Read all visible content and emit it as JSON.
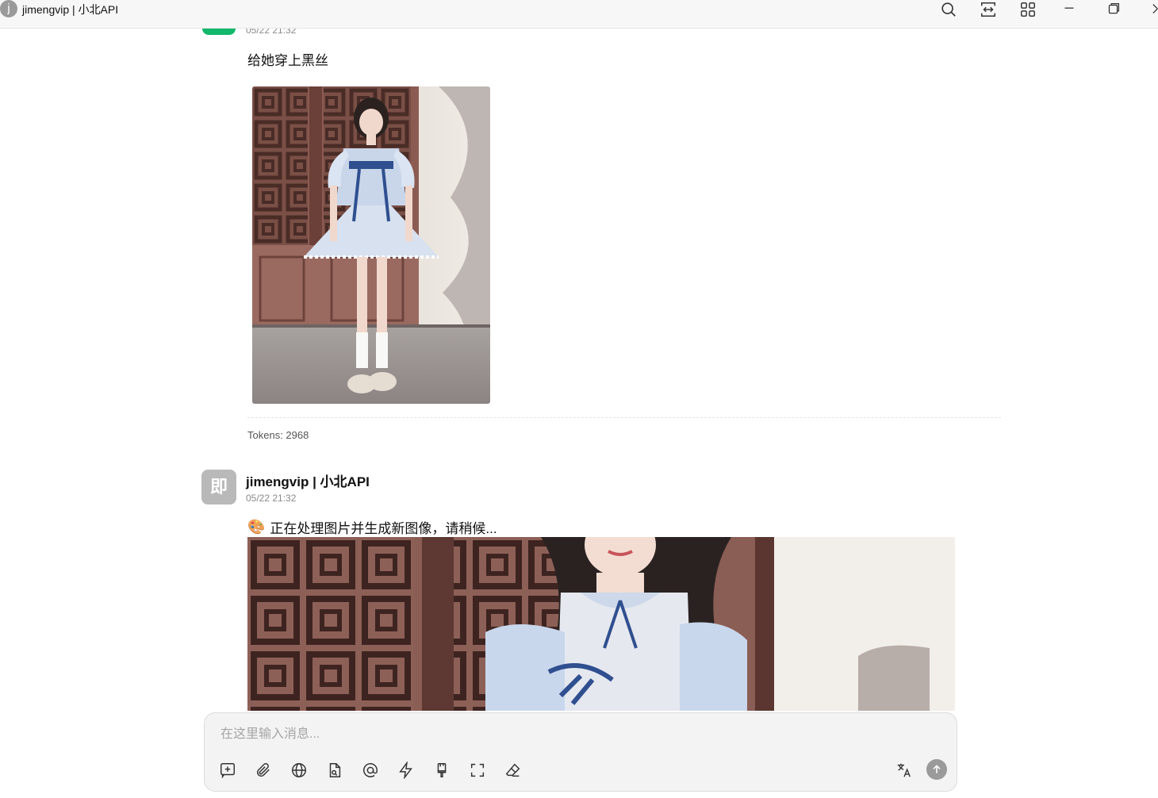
{
  "window": {
    "avatar_letter": "j",
    "title": "jimengvip | 小北API",
    "controls": [
      "search-icon",
      "screen-capture-icon",
      "apps-grid-icon",
      "minimize-icon",
      "restore-icon",
      "close-icon"
    ]
  },
  "messages": [
    {
      "role": "user",
      "time": "05/22 21:32",
      "text": "给她穿上黑丝",
      "has_image": true,
      "tokens_label": "Tokens: 2968"
    },
    {
      "role": "assistant",
      "avatar_text": "即",
      "name": "jimengvip | 小北API",
      "time": "05/22 21:32",
      "emoji": "🎨",
      "text": "正在处理图片并生成新图像，请稍候...",
      "has_image": true
    }
  ],
  "composer": {
    "placeholder": "在这里输入消息...",
    "tools": [
      "new-chat-icon",
      "attachment-icon",
      "web-search-icon",
      "file-icon",
      "mention-icon",
      "lightning-icon",
      "brush-icon",
      "fullscreen-icon",
      "eraser-icon"
    ],
    "right_tools": [
      "translate-icon",
      "send-icon"
    ]
  },
  "colors": {
    "user_avatar": "#12b76a",
    "bot_avatar": "#b9b9b9",
    "send_button": "#9a9a9a"
  }
}
